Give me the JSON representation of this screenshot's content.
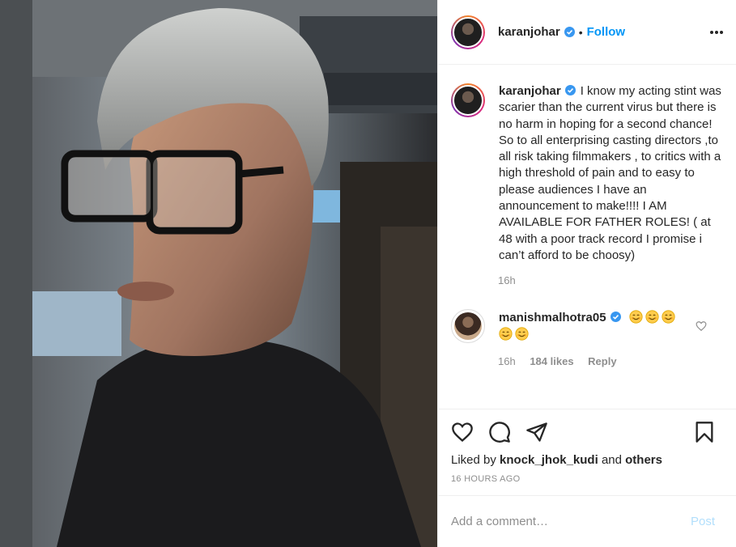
{
  "photo": {
    "alt_subject": "selfie-photo"
  },
  "header": {
    "username": "karanjohar",
    "separator": "•",
    "follow_label": "Follow",
    "more_icon": "more-horizontal-icon"
  },
  "caption": {
    "username": "karanjohar",
    "text": "I know my acting stint was scarier than the current virus but there is no harm in hoping for a second chance! So to all enterprising casting directors ,to all risk taking filmmakers , to critics with a high threshold of pain and to easy to please audiences I have an announcement to make!!!! I AM AVAILABLE FOR FATHER ROLES! ( at 48 with a poor track record I promise i can’t afford to be choosy)",
    "time": "16h"
  },
  "comments": [
    {
      "username": "manishmalhotra05",
      "emojis": [
        "smiling-face-emoji",
        "smiling-face-emoji",
        "smiling-face-emoji",
        "smiling-face-emoji",
        "smiling-face-emoji"
      ],
      "time": "16h",
      "likes": "184 likes",
      "reply_label": "Reply"
    }
  ],
  "actions": {
    "liked_by_prefix": "Liked by",
    "liked_by_user": "knock_jhok_kudi",
    "liked_by_and": "and",
    "liked_by_others": "others",
    "posted_ago": "16 HOURS AGO"
  },
  "add_comment": {
    "placeholder": "Add a comment…",
    "post_label": "Post"
  },
  "colors": {
    "link_blue": "#0095f6",
    "verified_blue": "#3897f0",
    "post_disabled": "#b2dffc",
    "muted_text": "#8e8e8e"
  }
}
